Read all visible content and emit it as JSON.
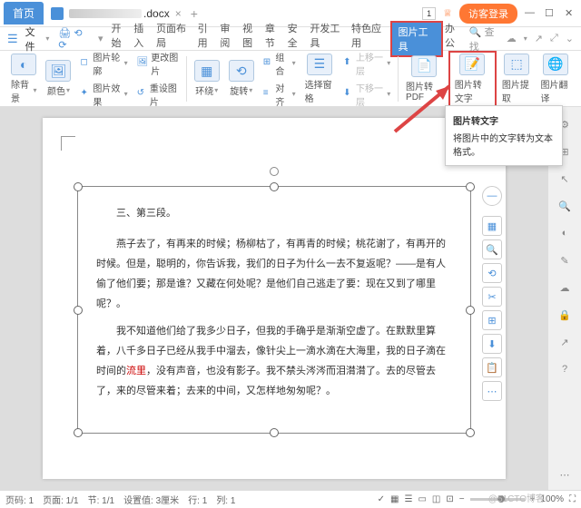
{
  "titlebar": {
    "home": "首页",
    "doc_ext": ".docx",
    "login": "访客登录",
    "counter": "1"
  },
  "menubar": {
    "file": "文件",
    "tabs": [
      "开始",
      "插入",
      "页面布局",
      "引用",
      "审阅",
      "视图",
      "章节",
      "安全",
      "开发工具",
      "特色应用"
    ],
    "active": "图片工具",
    "after": "办公",
    "search": "查找"
  },
  "ribbon": {
    "g1": {
      "label": "除背景"
    },
    "g2": {
      "label": "颜色"
    },
    "g3": {
      "a": "图片轮廓",
      "b": "图片效果"
    },
    "g4": {
      "a": "更改图片",
      "b": "重设图片"
    },
    "g5": {
      "label": "环绕"
    },
    "g6": {
      "label": "旋转"
    },
    "g7": {
      "a": "组合",
      "b": "对齐"
    },
    "g8": {
      "label": "选择窗格"
    },
    "g9": {
      "a": "上移一层",
      "b": "下移一层"
    },
    "g10": {
      "label": "图片转PDF"
    },
    "g11": {
      "label": "图片转文字"
    },
    "g12": {
      "label": "图片提取"
    },
    "g13": {
      "label": "图片翻译"
    }
  },
  "tooltip": {
    "title": "图片转文字",
    "desc": "将图片中的文字转为文本格式。"
  },
  "content": {
    "heading": "三、第三段。",
    "p1": "燕子去了，有再来的时候；杨柳枯了，有再青的时候；桃花谢了，有再开的时候。但是，聪明的，你告诉我，我们的日子为什么一去不复返呢？——是有人偷了他们要；那是谁？又藏在何处呢？是他们自己逃走了要：现在又到了哪里呢？。",
    "p2a": "我不知道他们给了我多少日子，但我的手确乎是渐渐空虚了。在默默里算着，八千多日子已经从我手中溜去，像针尖上一滴水滴在大海里，我的日子滴在时间的",
    "p2_red": "流里",
    "p2b": "，没有声音，也没有影子。我不禁头涔涔而泪潸潸了。去的尽管去了，来的尽管来着；去来的中间，又怎样地匆匆呢？。"
  },
  "statusbar": {
    "page": "页码: 1",
    "pages": "页面: 1/1",
    "section": "节: 1/1",
    "pos": "设置值: 3厘米",
    "line": "行: 1",
    "col": "列: 1",
    "zoom": "100%"
  },
  "watermark": "@51CTO博客"
}
